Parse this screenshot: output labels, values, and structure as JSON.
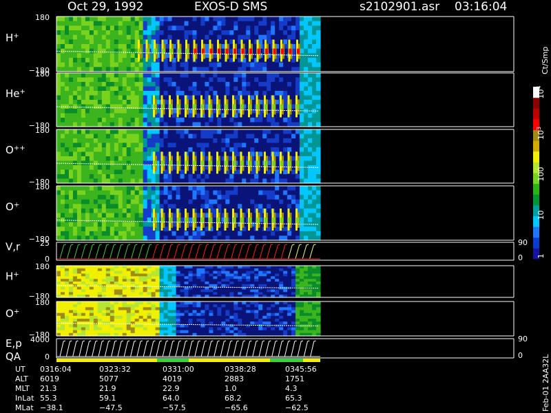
{
  "header": {
    "date": "Oct 29, 1992",
    "instrument": "EXOS-D SMS",
    "filename": "s2102901.asr",
    "time": "03:16:04"
  },
  "footer_tag": "Feb-01 2AA32L",
  "colorbar": {
    "unit": "Ct/Smp",
    "ticks": [
      {
        "label": "10",
        "sup": "4",
        "value": 10000
      },
      {
        "label": "10",
        "sup": "3",
        "value": 1000
      },
      {
        "label": "100",
        "sup": "",
        "value": 100
      },
      {
        "label": "10",
        "sup": "",
        "value": 10
      },
      {
        "label": "1",
        "sup": "",
        "value": 1
      }
    ],
    "colors": [
      "#1414a0",
      "#0a3cd2",
      "#1e78ff",
      "#00c8ff",
      "#00a0a0",
      "#009632",
      "#28b414",
      "#78d21e",
      "#b4e632",
      "#f0f000",
      "#d2aa00",
      "#a08c14",
      "#ff0000",
      "#be0000",
      "#8c0000",
      "#ffffff"
    ]
  },
  "chart_data": {
    "type": "heatmap",
    "panels": [
      {
        "label": "H",
        "sup": "+",
        "ymax_label": "180",
        "ymin_label": "−180",
        "kind": "heatmap",
        "ylim": [
          -180,
          180
        ]
      },
      {
        "label": "He",
        "sup": "+",
        "ymax_label": "180",
        "ymin_label": "−180",
        "kind": "heatmap",
        "ylim": [
          -180,
          180
        ]
      },
      {
        "label": "O",
        "sup": "++",
        "ymax_label": "180",
        "ymin_label": "−180",
        "kind": "heatmap",
        "ylim": [
          -180,
          180
        ]
      },
      {
        "label": "O",
        "sup": "+",
        "ymax_label": "180",
        "ymin_label": "−180",
        "kind": "heatmap",
        "ylim": [
          -180,
          180
        ]
      },
      {
        "label": "V,r",
        "sup": "",
        "ymax_label": "25",
        "ymin_label": "0",
        "right_top": "90",
        "right_bottom": "0",
        "kind": "line",
        "ylim": [
          0,
          25
        ]
      },
      {
        "label": "H",
        "sup": "+",
        "ymax_label": "180",
        "ymin_label": "−180",
        "kind": "heatmap",
        "ylim": [
          -180,
          180
        ]
      },
      {
        "label": "O",
        "sup": "+",
        "ymax_label": "180",
        "ymin_label": "−180",
        "kind": "heatmap",
        "ylim": [
          -180,
          180
        ]
      },
      {
        "label": "E,p",
        "label2": "QA",
        "sup": "",
        "ymax_label": "4000",
        "ymin_label": "0",
        "right_top": "90",
        "right_bottom": "0",
        "kind": "line",
        "ylim": [
          0,
          4000
        ]
      }
    ],
    "time_axis": {
      "row_labels": [
        "UT",
        "ALT",
        "MLT",
        "InLat",
        "MLat"
      ],
      "columns": [
        [
          "0316:04",
          "6019",
          "21.3",
          "55.3",
          "−38.1"
        ],
        [
          "0323:32",
          "5077",
          "21.9",
          "59.1",
          "−47.5"
        ],
        [
          "0331:00",
          "4019",
          "22.9",
          "64.0",
          "−57.5"
        ],
        [
          "0338:28",
          "2883",
          "1.0",
          "68.2",
          "−65.6"
        ],
        [
          "0345:56",
          "1751",
          "4.3",
          "65.3",
          "−62.5"
        ]
      ]
    }
  }
}
